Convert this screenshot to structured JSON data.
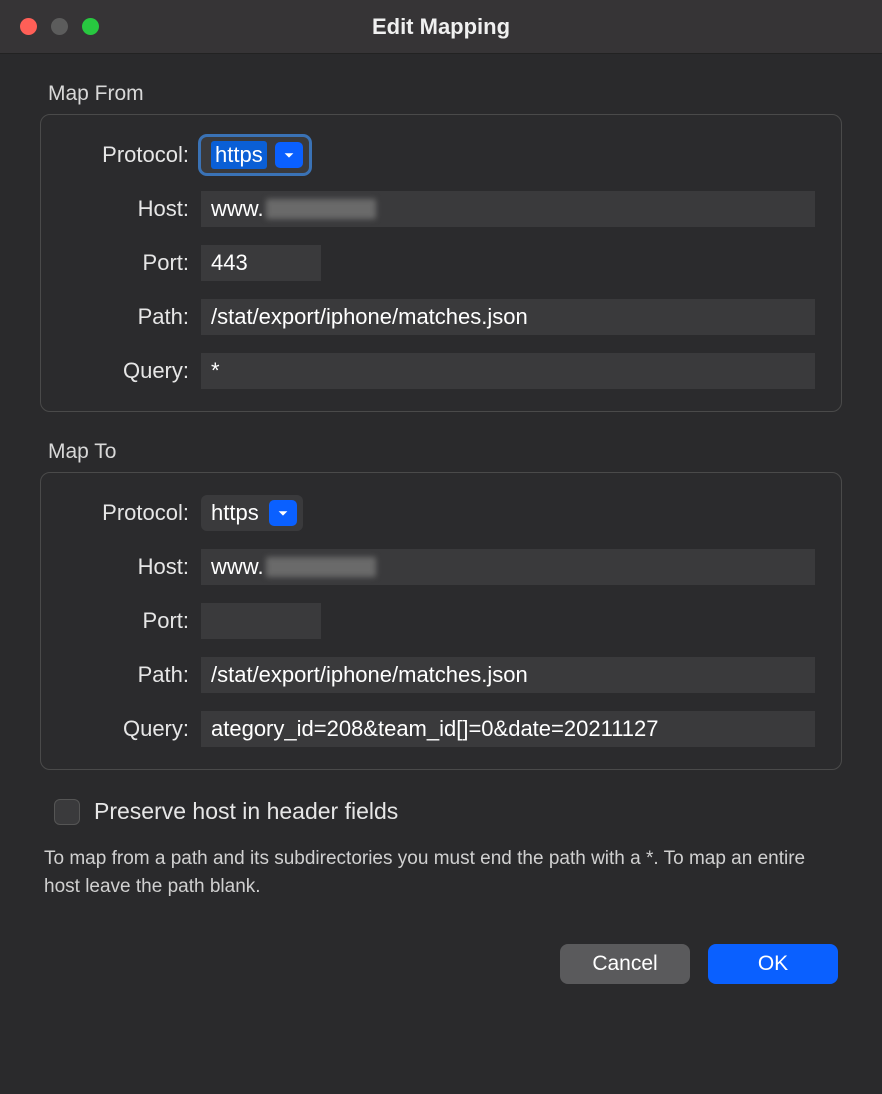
{
  "window": {
    "title": "Edit Mapping"
  },
  "mapFrom": {
    "legend": "Map From",
    "protocolLabel": "Protocol:",
    "protocolValue": "https",
    "hostLabel": "Host:",
    "hostValue": "www.",
    "portLabel": "Port:",
    "portValue": "443",
    "pathLabel": "Path:",
    "pathValue": "/stat/export/iphone/matches.json",
    "queryLabel": "Query:",
    "queryValue": "*"
  },
  "mapTo": {
    "legend": "Map To",
    "protocolLabel": "Protocol:",
    "protocolValue": "https",
    "hostLabel": "Host:",
    "hostValue": "www.",
    "portLabel": "Port:",
    "portValue": "",
    "pathLabel": "Path:",
    "pathValue": "/stat/export/iphone/matches.json",
    "queryLabel": "Query:",
    "queryValue": "ategory_id=208&team_id[]=0&date=20211127"
  },
  "preserveHost": {
    "label": "Preserve host in header fields",
    "checked": false
  },
  "helpText": "To map from a path and its subdirectories you must end the path with a *. To map an entire host leave the path blank.",
  "buttons": {
    "cancel": "Cancel",
    "ok": "OK"
  }
}
